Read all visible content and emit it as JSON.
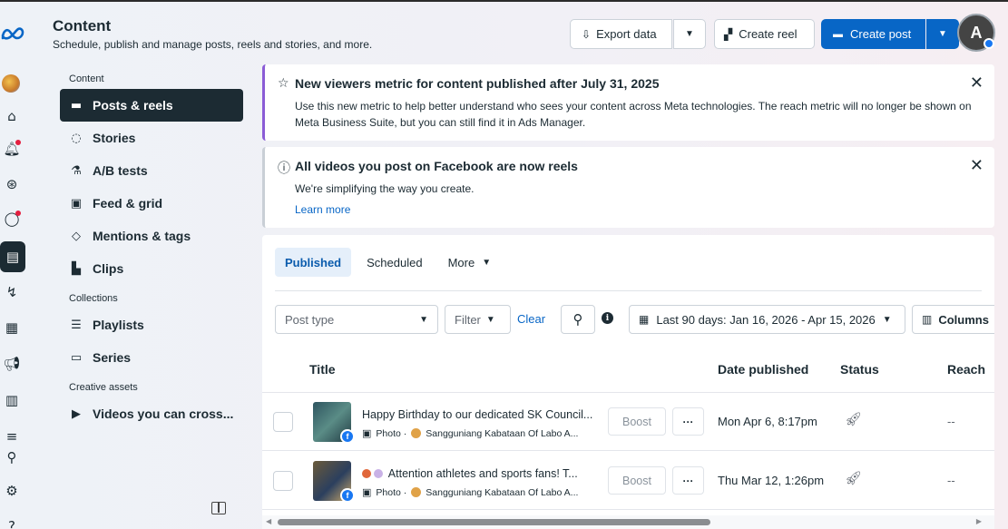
{
  "header": {
    "title": "Content",
    "subtitle": "Schedule, publish and manage posts, reels and stories, and more.",
    "export_label": "Export data",
    "create_reel_label": "Create reel",
    "create_post_label": "Create post",
    "profile_initial": "A"
  },
  "sidebar": {
    "section_content": "Content",
    "section_collections": "Collections",
    "section_creative": "Creative assets",
    "items": [
      {
        "label": "Posts & reels",
        "icon": "posts-icon"
      },
      {
        "label": "Stories",
        "icon": "stories-icon"
      },
      {
        "label": "A/B tests",
        "icon": "flask-icon"
      },
      {
        "label": "Feed & grid",
        "icon": "grid-icon"
      },
      {
        "label": "Mentions & tags",
        "icon": "tag-icon"
      },
      {
        "label": "Clips",
        "icon": "clapper-icon"
      },
      {
        "label": "Playlists",
        "icon": "playlist-icon"
      },
      {
        "label": "Series",
        "icon": "tv-icon"
      },
      {
        "label": "Videos you can cross...",
        "icon": "video-icon"
      }
    ]
  },
  "banners": {
    "one": {
      "title": "New viewers metric for content published after July 31, 2025",
      "text": "Use this new metric to help better understand who sees your content across Meta technologies. The reach metric will no longer be shown on Meta Business Suite, but you can still find it in Ads Manager."
    },
    "two": {
      "title": "All videos you post on Facebook are now reels",
      "text": "We're simplifying the way you create.",
      "link": "Learn more"
    }
  },
  "tabs": [
    "Published",
    "Scheduled",
    "More"
  ],
  "filters": {
    "post_type_placeholder": "Post type",
    "filter_label": "Filter",
    "clear_label": "Clear",
    "date_range": "Last 90 days: Jan 16, 2026 - Apr 15, 2026",
    "columns_label": "Columns"
  },
  "table": {
    "headers": {
      "title": "Title",
      "date": "Date published",
      "status": "Status",
      "reach": "Reach"
    },
    "rows": [
      {
        "title": "Happy Birthday to our dedicated SK Council...",
        "type": "Photo ·",
        "page": "Sangguniang Kabataan Of Labo A...",
        "boost": "Boost",
        "more": "···",
        "date": "Mon Apr 6, 8:17pm",
        "reach": "--"
      },
      {
        "title": "Attention athletes and sports fans! T...",
        "type": "Photo ·",
        "page": "Sangguniang Kabataan Of Labo A...",
        "boost": "Boost",
        "more": "···",
        "date": "Thu Mar 12, 1:26pm",
        "reach": "--"
      }
    ]
  },
  "colors": {
    "accent": "#0866c6",
    "dark": "#1c2b33",
    "notification": "#e41e3f"
  }
}
